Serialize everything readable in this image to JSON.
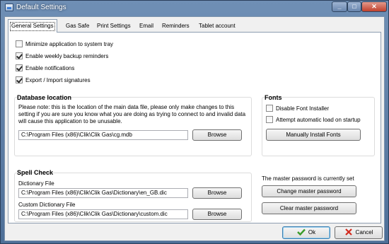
{
  "window": {
    "title": "Default Settings"
  },
  "tabs": [
    "General Settings",
    "Gas Safe",
    "Print Settings",
    "Email",
    "Reminders",
    "Tablet account"
  ],
  "general": {
    "options": [
      {
        "label": "Minimize application to system tray",
        "checked": false
      },
      {
        "label": "Enable weekly backup reminders",
        "checked": true
      },
      {
        "label": "Enable notifications",
        "checked": true
      },
      {
        "label": "Export / Import signatures",
        "checked": true
      }
    ]
  },
  "database": {
    "heading": "Database location",
    "note": "Please note: this is the location of the main data file, please only make changes to this setting if you are sure you know what you are doing as trying to connect to and invalid data will cause this application to be unusable.",
    "path": "C:\\Program Files (x86)\\Clik\\Clik Gas\\cg.mdb",
    "browse_label": "Browse"
  },
  "fonts": {
    "heading": "Fonts",
    "options": [
      {
        "label": "Disable Font Installer",
        "checked": false
      },
      {
        "label": "Attempt automatic load on startup",
        "checked": false
      }
    ],
    "install_label": "Manually Install Fonts"
  },
  "spell": {
    "heading": "Spell Check",
    "dictionary_label": "Dictionary File",
    "dictionary_path": "C:\\Program Files (x86)\\Clik\\Clik Gas\\Dictionary\\en_GB.dic",
    "custom_label": "Custom Dictionary File",
    "custom_path": "C:\\Program Files (x86)\\Clik\\Clik Gas\\Dictionary\\custom.dic",
    "browse_label": "Browse"
  },
  "password": {
    "status": "The master password is currently set",
    "change_label": "Change master password",
    "clear_label": "Clear master password"
  },
  "footer": {
    "ok_label": "Ok",
    "cancel_label": "Cancel"
  },
  "colors": {
    "ok_icon": "#3a9b2a",
    "cancel_icon": "#d22a1e",
    "title_bar": "#5b7ca6"
  }
}
